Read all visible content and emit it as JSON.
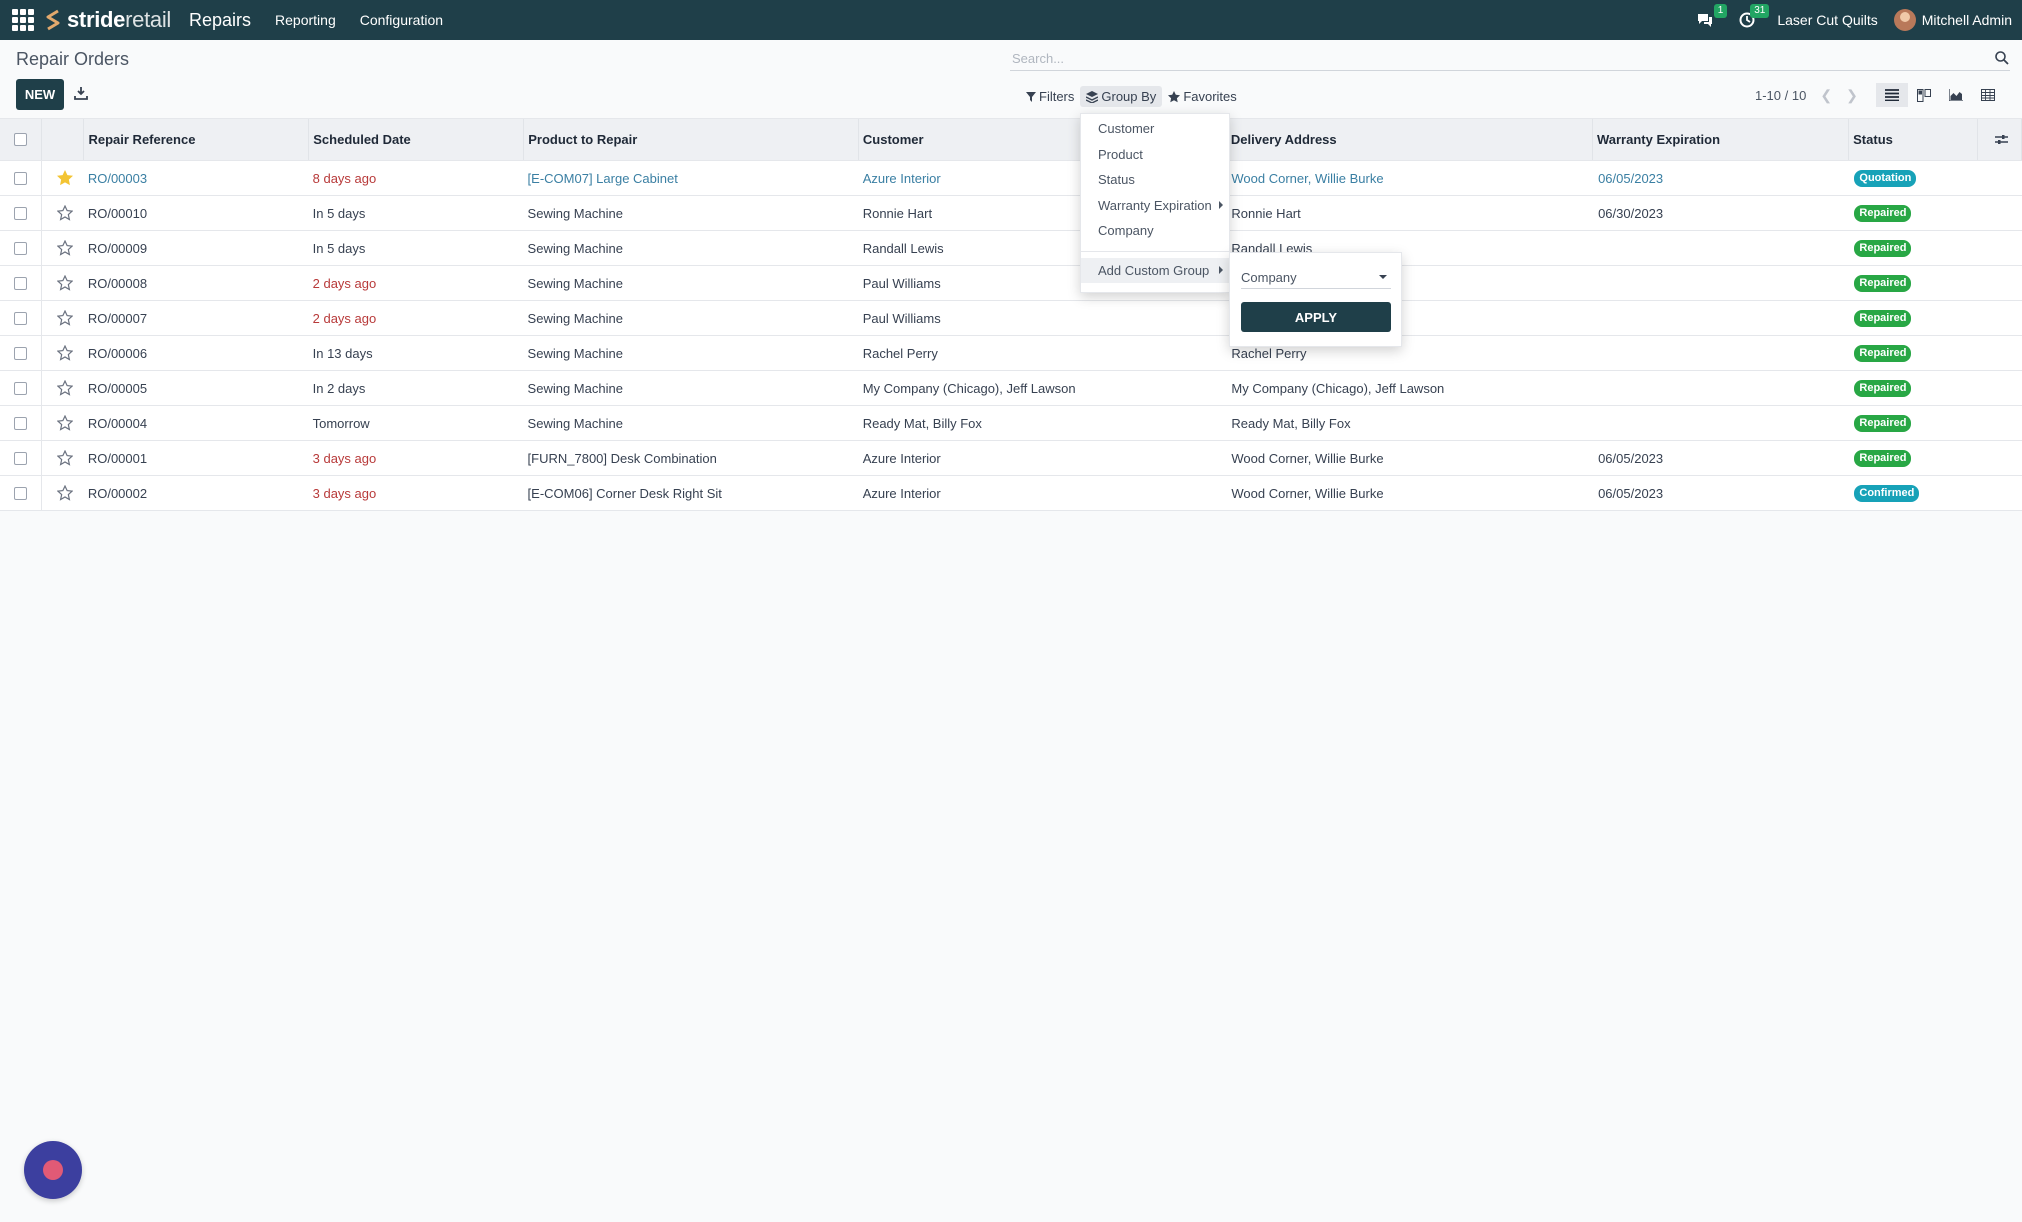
{
  "navbar": {
    "logo_bold": "stride",
    "logo_light": "retail",
    "app_name": "Repairs",
    "menus": [
      "Reporting",
      "Configuration"
    ],
    "messages_count": "1",
    "activities_count": "31",
    "company": "Laser Cut Quilts",
    "user": "Mitchell Admin"
  },
  "page": {
    "title": "Repair Orders",
    "search_placeholder": "Search...",
    "new_label": "NEW"
  },
  "panel": {
    "filters": "Filters",
    "group_by": "Group By",
    "favorites": "Favorites"
  },
  "pager": {
    "value": "1-10 / 10"
  },
  "table": {
    "headers": {
      "ref": "Repair Reference",
      "date": "Scheduled Date",
      "product": "Product to Repair",
      "customer": "Customer",
      "delivery": "Delivery Address",
      "warranty": "Warranty Expiration",
      "status": "Status"
    },
    "rows": [
      {
        "ref": "RO/00003",
        "date": "8 days ago",
        "product": "[E-COM07] Large Cabinet",
        "customer": "Azure Interior",
        "delivery": "Wood Corner, Willie Burke",
        "warranty": "06/05/2023",
        "status": "Quotation"
      },
      {
        "ref": "RO/00010",
        "date": "In 5 days",
        "product": "Sewing Machine",
        "customer": "Ronnie Hart",
        "delivery": "Ronnie Hart",
        "warranty": "06/30/2023",
        "status": "Repaired"
      },
      {
        "ref": "RO/00009",
        "date": "In 5 days",
        "product": "Sewing Machine",
        "customer": "Randall Lewis",
        "delivery": "Randall Lewis",
        "warranty": "",
        "status": "Repaired"
      },
      {
        "ref": "RO/00008",
        "date": "2 days ago",
        "product": "Sewing Machine",
        "customer": "Paul Williams",
        "delivery": "",
        "warranty": "",
        "status": "Repaired"
      },
      {
        "ref": "RO/00007",
        "date": "2 days ago",
        "product": "Sewing Machine",
        "customer": "Paul Williams",
        "delivery": "",
        "warranty": "",
        "status": "Repaired"
      },
      {
        "ref": "RO/00006",
        "date": "In 13 days",
        "product": "Sewing Machine",
        "customer": "Rachel Perry",
        "delivery": "Rachel Perry",
        "warranty": "",
        "status": "Repaired"
      },
      {
        "ref": "RO/00005",
        "date": "In 2 days",
        "product": "Sewing Machine",
        "customer": "My Company (Chicago), Jeff Lawson",
        "delivery": "My Company (Chicago), Jeff Lawson",
        "warranty": "",
        "status": "Repaired"
      },
      {
        "ref": "RO/00004",
        "date": "Tomorrow",
        "product": "Sewing Machine",
        "customer": "Ready Mat, Billy Fox",
        "delivery": "Ready Mat, Billy Fox",
        "warranty": "",
        "status": "Repaired"
      },
      {
        "ref": "RO/00001",
        "date": "3 days ago",
        "product": "[FURN_7800] Desk Combination",
        "customer": "Azure Interior",
        "delivery": "Wood Corner, Willie Burke",
        "warranty": "06/05/2023",
        "status": "Repaired"
      },
      {
        "ref": "RO/00002",
        "date": "3 days ago",
        "product": "[E-COM06] Corner Desk Right Sit",
        "customer": "Azure Interior",
        "delivery": "Wood Corner, Willie Burke",
        "warranty": "06/05/2023",
        "status": "Confirmed"
      }
    ]
  },
  "groupby_menu": {
    "items": [
      "Customer",
      "Product",
      "Status",
      "Warranty Expiration",
      "Company"
    ],
    "custom": "Add Custom Group",
    "custom_select": "Company",
    "apply": "APPLY"
  },
  "colors": {
    "primary": "#1f3f49",
    "link": "#3a7fa3",
    "overdue": "#b83a3a",
    "repaired": "#28a745",
    "quotation": "#17a2b8"
  }
}
